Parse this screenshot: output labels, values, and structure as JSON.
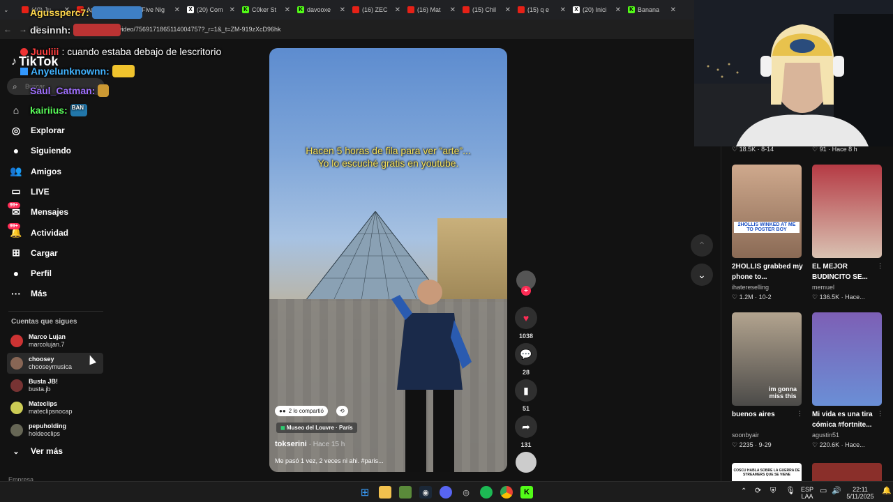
{
  "browser": {
    "tabs": [
      {
        "title": "(40) Ju",
        "kind": "yt"
      },
      {
        "title": "Agusperc7",
        "kind": "yt"
      },
      {
        "title": "Five Nig",
        "kind": "g"
      },
      {
        "title": "(20) Com",
        "kind": "x"
      },
      {
        "title": "C0ker St",
        "kind": "k"
      },
      {
        "title": "davooxe",
        "kind": "k"
      },
      {
        "title": "(16) ZEC",
        "kind": "yt"
      },
      {
        "title": "(16) Mat",
        "kind": "yt"
      },
      {
        "title": "(15) Chil",
        "kind": "yt"
      },
      {
        "title": "(15) q e",
        "kind": "yt"
      },
      {
        "title": "(20) Inici",
        "kind": "x"
      },
      {
        "title": "Banana",
        "kind": "k"
      }
    ],
    "url": "serini/video/7569171865114004757?_r=1&_t=ZM-919zXcD96hk"
  },
  "chat": [
    {
      "user": "Agussperc7:",
      "color": "#ffd84d",
      "msg": "",
      "emote": "#3e7fc5"
    },
    {
      "user": "desinnh:",
      "color": "#dddddd",
      "msg": "",
      "emote": "#b33"
    },
    {
      "user": "Juuliii",
      "color": "#ff4040",
      "msg": ": cuando estaba debajo de lescritorio",
      "emote": ""
    },
    {
      "user": "Anyelunknownn:",
      "color": "#41b3ff",
      "msg": "",
      "emote": "#f0c32d"
    },
    {
      "user": "Saul_Catman:",
      "color": "#a070ff",
      "msg": "",
      "emote": "#c93"
    },
    {
      "user": "kairiius:",
      "color": "#5bff5b",
      "msg": "",
      "emote": "#27a"
    }
  ],
  "emote_labels": {
    "ban": "BAN"
  },
  "sidebar": {
    "logo": "TikTok",
    "search_placeholder": "Buscar",
    "nav": [
      {
        "label": "Explorar",
        "icon": "compass-icon",
        "glyph": "◎"
      },
      {
        "label": "Siguiendo",
        "icon": "following-icon",
        "glyph": "●"
      },
      {
        "label": "Amigos",
        "icon": "friends-icon",
        "glyph": "👥"
      },
      {
        "label": "LIVE",
        "icon": "live-icon",
        "glyph": "▭"
      },
      {
        "label": "Mensajes",
        "icon": "messages-icon",
        "glyph": "✉",
        "badge": "99+"
      },
      {
        "label": "Actividad",
        "icon": "activity-icon",
        "glyph": "🔔",
        "badge": "99+"
      },
      {
        "label": "Cargar",
        "icon": "upload-icon",
        "glyph": "⊞"
      },
      {
        "label": "Perfil",
        "icon": "profile-icon",
        "glyph": "●"
      },
      {
        "label": "Más",
        "icon": "more-icon",
        "glyph": "···"
      }
    ],
    "following_title": "Cuentas que sigues",
    "following": [
      {
        "name": "Marco Lujan",
        "handle": "marcolujan.7",
        "color": "#c33"
      },
      {
        "name": "choosey",
        "handle": "chooseymusica",
        "color": "#865"
      },
      {
        "name": "Busta JB!",
        "handle": "busta.jb",
        "color": "#733"
      },
      {
        "name": "Mateclips",
        "handle": "mateclipsnocap",
        "color": "#cc5"
      },
      {
        "name": "pepuholding",
        "handle": "holdeoclips",
        "color": "#665"
      }
    ],
    "see_more": "Ver más",
    "cut_label": "Empresa"
  },
  "video": {
    "caption_line1": "Hacen 5 horas de fila para ver “arte”...",
    "caption_line2": "Yo lo escuché gratis en youtube.",
    "shared": "2 lo compartió",
    "location": "Museo del Louvre · París",
    "author": "tokserini",
    "time": " · Hace 15 h",
    "description": "Me pasó 1 vez, 2 veces ni ahi. #paris..."
  },
  "actions": {
    "likes": "1038",
    "comments": "28",
    "saves": "51",
    "shares": "131"
  },
  "right_panel": {
    "top_stats": [
      {
        "likes": "18.5K",
        "date": "8-14"
      },
      {
        "likes": "91",
        "date": "Hace 8 h"
      }
    ],
    "videos": [
      {
        "title": "2HOLLIS grabbed my phone to...",
        "author": "ihatereselling",
        "likes": "1.2M",
        "date": "10-2",
        "overlay": "2HOLLIS WINKED AT ME TO POSTER BOY"
      },
      {
        "title": "EL MEJOR BUDINCITO SE...",
        "author": "memuel",
        "likes": "136.5K",
        "date": "Hace...",
        "overlay": ""
      },
      {
        "title": "buenos aires",
        "author": "soonbyair",
        "likes": "2235",
        "date": "9-29",
        "overlay": "im gonna miss this"
      },
      {
        "title": "Mi vida es una tira cómica #fortnite...",
        "author": "agustin51",
        "likes": "220.6K",
        "date": "Hace...",
        "overlay": ""
      }
    ],
    "bottom_banner": "COSCU HABLA SOBRE LA GUERRA DE STREAMERS QUE SE VIENE"
  },
  "taskbar": {
    "lang": "ESP",
    "lang2": "LAA",
    "time": "22:11",
    "date": "5/11/2025"
  }
}
